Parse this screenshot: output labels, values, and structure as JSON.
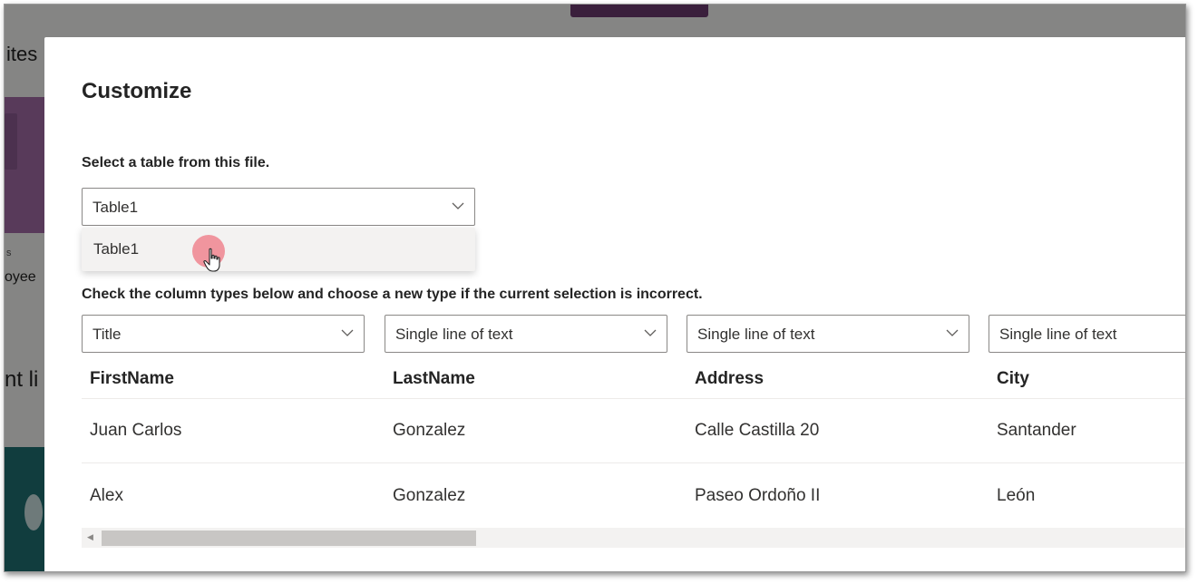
{
  "background": {
    "sites_fragment": "ites",
    "small_fragment": "s",
    "employee_fragment": "oyee",
    "list_fragment": "nt li"
  },
  "dialog": {
    "title": "Customize",
    "table_prompt": "Select a table from this file.",
    "table_select": {
      "value": "Table1",
      "options": [
        "Table1"
      ]
    },
    "column_prompt": "Check the column types below and choose a new type if the current selection is incorrect.",
    "column_types": [
      "Title",
      "Single line of text",
      "Single line of text",
      "Single line of text"
    ],
    "columns": [
      "FirstName",
      "LastName",
      "Address",
      "City"
    ],
    "rows": [
      [
        "Juan Carlos",
        "Gonzalez",
        "Calle Castilla 20",
        "Santander"
      ],
      [
        "Alex",
        "Gonzalez",
        "Paseo Ordoño II",
        "León"
      ]
    ],
    "horizontal_scroll_position": 0
  },
  "colors": {
    "background_accent": "#6a3a6e",
    "purple_card": "#a06aa5",
    "teal_card": "#1f6f72",
    "click_indicator": "#ef7682"
  },
  "icons": [
    "chevron-down-icon",
    "hand-pointer-icon",
    "scroll-left-arrow-icon"
  ]
}
